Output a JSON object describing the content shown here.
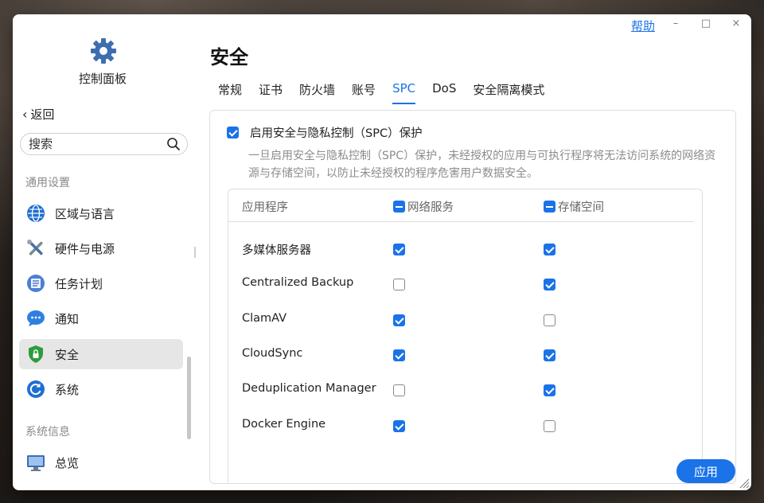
{
  "window": {
    "help_link": "帮助",
    "controls": [
      "–",
      "□",
      "×"
    ]
  },
  "sidebar": {
    "app_title": "控制面板",
    "back_label": "返回",
    "search_placeholder": "搜索",
    "sections": [
      {
        "title": "通用设置"
      },
      {
        "title": "系统信息"
      }
    ],
    "items": [
      {
        "label": "区域与语言",
        "icon": "globe-icon"
      },
      {
        "label": "硬件与电源",
        "icon": "tools-icon"
      },
      {
        "label": "任务计划",
        "icon": "task-list-icon"
      },
      {
        "label": "通知",
        "icon": "chat-bubble-icon"
      },
      {
        "label": "安全",
        "icon": "shield-icon",
        "active": true
      },
      {
        "label": "系统",
        "icon": "system-refresh-icon"
      },
      {
        "label": "总览",
        "icon": "monitor-icon"
      }
    ]
  },
  "main": {
    "title": "安全",
    "tabs": [
      {
        "label": "常规"
      },
      {
        "label": "证书"
      },
      {
        "label": "防火墙"
      },
      {
        "label": "账号"
      },
      {
        "label": "SPC",
        "active": true
      },
      {
        "label": "DoS"
      },
      {
        "label": "安全隔离模式"
      }
    ],
    "spc": {
      "enable_label": "启用安全与隐私控制（SPC）保护",
      "enabled": true,
      "description": "一旦启用安全与隐私控制（SPC）保护，未经授权的应用与可执行程序将无法访问系统的网络资源与存储空间，以防止未经授权的程序危害用户数据安全。",
      "table": {
        "columns": {
          "app": "应用程序",
          "network": "网络服务",
          "storage": "存储空间"
        },
        "rows": [
          {
            "app": "多媒体服务器",
            "network": true,
            "storage": true
          },
          {
            "app": "Centralized Backup",
            "network": false,
            "storage": true
          },
          {
            "app": "ClamAV",
            "network": true,
            "storage": false
          },
          {
            "app": "CloudSync",
            "network": true,
            "storage": true
          },
          {
            "app": "Deduplication Manager",
            "network": false,
            "storage": true
          },
          {
            "app": "Docker Engine",
            "network": true,
            "storage": false
          }
        ]
      }
    },
    "apply_label": "应用"
  },
  "colors": {
    "accent": "#1a73e8",
    "shield": "#2e9b3c"
  }
}
